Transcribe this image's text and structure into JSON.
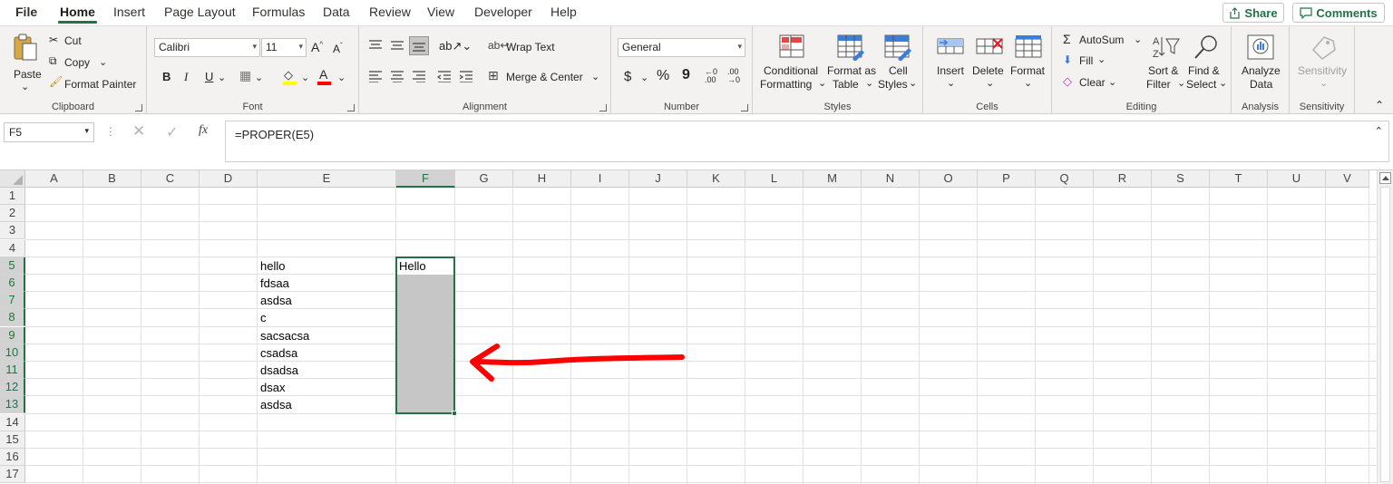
{
  "menu_tabs": [
    "File",
    "Home",
    "Insert",
    "Page Layout",
    "Formulas",
    "Data",
    "Review",
    "View",
    "Developer",
    "Help"
  ],
  "active_tab": "Home",
  "share_label": "Share",
  "comments_label": "Comments",
  "ribbon": {
    "clipboard": {
      "paste": "Paste",
      "cut": "Cut",
      "copy": "Copy",
      "format_painter": "Format Painter",
      "label": "Clipboard"
    },
    "font": {
      "name": "Calibri",
      "size": "11",
      "bold": "B",
      "italic": "I",
      "underline": "U",
      "label": "Font"
    },
    "alignment": {
      "wrap_text": "Wrap Text",
      "merge_center": "Merge & Center",
      "label": "Alignment"
    },
    "number": {
      "format": "General",
      "currency": "$",
      "percent": "%",
      "comma": "9",
      "label": "Number"
    },
    "styles": {
      "conditional": "Conditional",
      "conditional2": "Formatting",
      "format_as": "Format as",
      "format_as2": "Table",
      "cell": "Cell",
      "cell2": "Styles",
      "label": "Styles"
    },
    "cells": {
      "insert": "Insert",
      "delete": "Delete",
      "format": "Format",
      "label": "Cells"
    },
    "editing": {
      "autosum": "AutoSum",
      "fill": "Fill",
      "clear": "Clear",
      "sort": "Sort &",
      "sort2": "Filter",
      "find": "Find &",
      "find2": "Select",
      "label": "Editing"
    },
    "analysis": {
      "analyze": "Analyze",
      "analyze2": "Data",
      "label": "Analysis"
    },
    "sensitivity": {
      "btn": "Sensitivity",
      "label": "Sensitivity"
    }
  },
  "formula_bar": {
    "name_box": "F5",
    "fx": "fx",
    "formula": "=PROPER(E5)"
  },
  "columns": [
    "A",
    "B",
    "C",
    "D",
    "E",
    "F",
    "G",
    "H",
    "I",
    "J",
    "K",
    "L",
    "M",
    "N",
    "O",
    "P",
    "Q",
    "R",
    "S",
    "T",
    "U",
    "V"
  ],
  "rows": [
    "1",
    "2",
    "3",
    "4",
    "5",
    "6",
    "7",
    "8",
    "9",
    "10",
    "11",
    "12",
    "13",
    "14",
    "15",
    "16",
    "17"
  ],
  "selected_column": "F",
  "selected_rows": [
    "5",
    "6",
    "7",
    "8",
    "9",
    "10",
    "11",
    "12",
    "13"
  ],
  "column_e_values": [
    "hello",
    "fdsaa",
    "asdsa",
    "c",
    "sacsacsa",
    "csadsa",
    "dsadsa",
    "dsax",
    "asdsa"
  ],
  "f5_value": "Hello",
  "colors": {
    "excel_green": "#217346",
    "arrow_red": "#ff0000",
    "selection_gray": "#c6c6c6"
  }
}
